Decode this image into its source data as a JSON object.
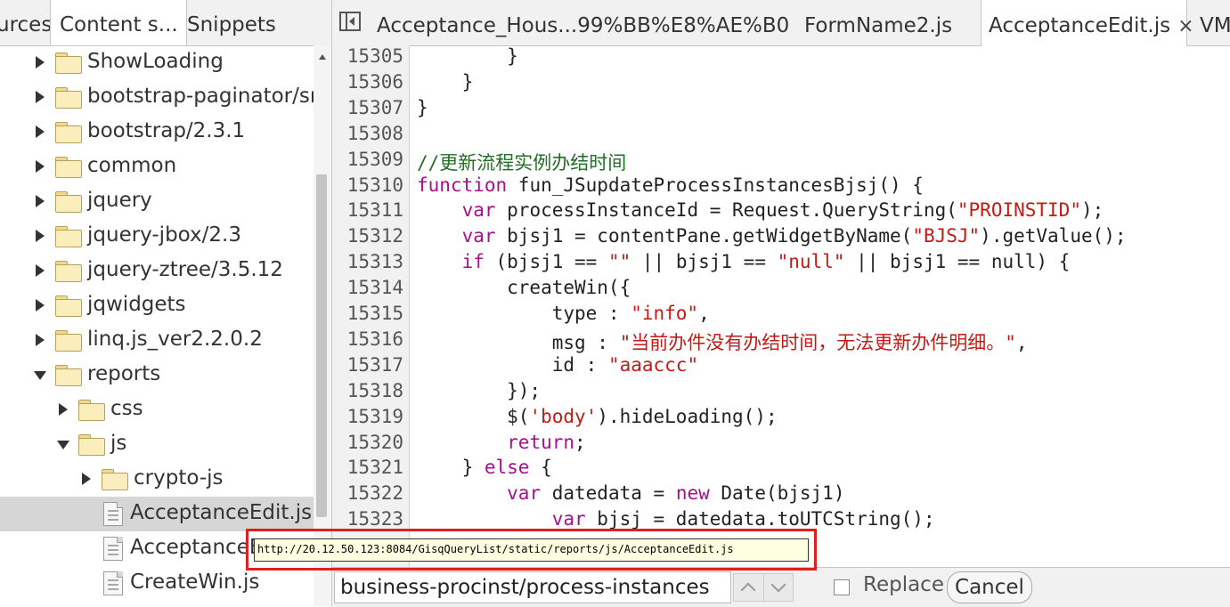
{
  "left_panel": {
    "tabs": [
      {
        "label": "urces"
      },
      {
        "label": "Content s..."
      },
      {
        "label": "Snippets"
      }
    ],
    "tree": [
      {
        "label": "ShowLoading",
        "type": "folder",
        "expanded": false
      },
      {
        "label": "bootstrap-paginator/sr",
        "type": "folder",
        "expanded": false
      },
      {
        "label": "bootstrap/2.3.1",
        "type": "folder",
        "expanded": false
      },
      {
        "label": "common",
        "type": "folder",
        "expanded": false
      },
      {
        "label": "jquery",
        "type": "folder",
        "expanded": false
      },
      {
        "label": "jquery-jbox/2.3",
        "type": "folder",
        "expanded": false
      },
      {
        "label": "jquery-ztree/3.5.12",
        "type": "folder",
        "expanded": false
      },
      {
        "label": "jqwidgets",
        "type": "folder",
        "expanded": false
      },
      {
        "label": "linq.js_ver2.2.0.2",
        "type": "folder",
        "expanded": false
      },
      {
        "label": "reports",
        "type": "folder",
        "expanded": true
      },
      {
        "label": "css",
        "type": "folder",
        "expanded": false
      },
      {
        "label": "js",
        "type": "folder",
        "expanded": true
      },
      {
        "label": "crypto-js",
        "type": "folder",
        "expanded": false
      },
      {
        "label": "AcceptanceEdit.js",
        "type": "file",
        "selected": true
      },
      {
        "label": "AcceptanceE",
        "type": "file"
      },
      {
        "label": "CreateWin.js",
        "type": "file"
      }
    ]
  },
  "editor": {
    "tabs": [
      {
        "label": "Acceptance_Hous...99%BB%E8%AE%B0"
      },
      {
        "label": "FormName2.js"
      },
      {
        "label": "AcceptanceEdit.js",
        "active": true,
        "close": "×"
      },
      {
        "label": "VM"
      }
    ],
    "lines": [
      {
        "n": "15305",
        "tokens": [
          {
            "t": "        }"
          }
        ]
      },
      {
        "n": "15306",
        "tokens": [
          {
            "t": "    }"
          }
        ]
      },
      {
        "n": "15307",
        "tokens": [
          {
            "t": "}"
          }
        ]
      },
      {
        "n": "15308",
        "tokens": []
      },
      {
        "n": "15309",
        "tokens": [
          {
            "t": "//更新流程实例办结时间",
            "c": "cmt"
          }
        ]
      },
      {
        "n": "15310",
        "tokens": [
          {
            "t": "function",
            "c": "kw"
          },
          {
            "t": " fun_JSupdateProcessInstancesBjsj() {"
          }
        ]
      },
      {
        "n": "15311",
        "tokens": [
          {
            "t": "    "
          },
          {
            "t": "var",
            "c": "kw"
          },
          {
            "t": " processInstanceId = Request.QueryString("
          },
          {
            "t": "\"PROINSTID\"",
            "c": "str"
          },
          {
            "t": ");"
          }
        ]
      },
      {
        "n": "15312",
        "tokens": [
          {
            "t": "    "
          },
          {
            "t": "var",
            "c": "kw"
          },
          {
            "t": " bjsj1 = contentPane.getWidgetByName("
          },
          {
            "t": "\"BJSJ\"",
            "c": "str"
          },
          {
            "t": ").getValue();"
          }
        ]
      },
      {
        "n": "15313",
        "tokens": [
          {
            "t": "    "
          },
          {
            "t": "if",
            "c": "kw"
          },
          {
            "t": " (bjsj1 == "
          },
          {
            "t": "\"\"",
            "c": "str"
          },
          {
            "t": " || bjsj1 == "
          },
          {
            "t": "\"null\"",
            "c": "str"
          },
          {
            "t": " || bjsj1 == null) {"
          }
        ]
      },
      {
        "n": "15314",
        "tokens": [
          {
            "t": "        createWin({"
          }
        ]
      },
      {
        "n": "15315",
        "tokens": [
          {
            "t": "            type : "
          },
          {
            "t": "\"info\"",
            "c": "str"
          },
          {
            "t": ","
          }
        ]
      },
      {
        "n": "15316",
        "tokens": [
          {
            "t": "            msg : "
          },
          {
            "t": "\"当前办件没有办结时间，无法更新办件明细。\"",
            "c": "str"
          },
          {
            "t": ","
          }
        ]
      },
      {
        "n": "15317",
        "tokens": [
          {
            "t": "            id : "
          },
          {
            "t": "\"aaaccc\"",
            "c": "str"
          }
        ]
      },
      {
        "n": "15318",
        "tokens": [
          {
            "t": "        });"
          }
        ]
      },
      {
        "n": "15319",
        "tokens": [
          {
            "t": "        $("
          },
          {
            "t": "'body'",
            "c": "str"
          },
          {
            "t": ").hideLoading();"
          }
        ]
      },
      {
        "n": "15320",
        "tokens": [
          {
            "t": "        "
          },
          {
            "t": "return",
            "c": "kw"
          },
          {
            "t": ";"
          }
        ]
      },
      {
        "n": "15321",
        "tokens": [
          {
            "t": "    } "
          },
          {
            "t": "else",
            "c": "kw"
          },
          {
            "t": " {"
          }
        ]
      },
      {
        "n": "15322",
        "tokens": [
          {
            "t": "        "
          },
          {
            "t": "var",
            "c": "kw"
          },
          {
            "t": " datedata = "
          },
          {
            "t": "new",
            "c": "kw"
          },
          {
            "t": " Date(bjsj1)"
          }
        ]
      },
      {
        "n": "15323",
        "tokens": [
          {
            "t": "            "
          },
          {
            "t": "var",
            "c": "kw"
          },
          {
            "t": " bjsj = datedata.toUTCString();"
          }
        ]
      }
    ]
  },
  "search": {
    "query": "business-procinst/process-instances",
    "replace_label": "Replace",
    "cancel_label": "Cancel"
  },
  "tooltip": {
    "text": "http://20.12.50.123:8084/GisqQueryList/static/reports/js/AcceptanceEdit.js"
  },
  "colors": {
    "keyword": "#aa0d91",
    "string": "#c41a16",
    "comment": "#236e25",
    "highlight_box": "#e02020"
  }
}
